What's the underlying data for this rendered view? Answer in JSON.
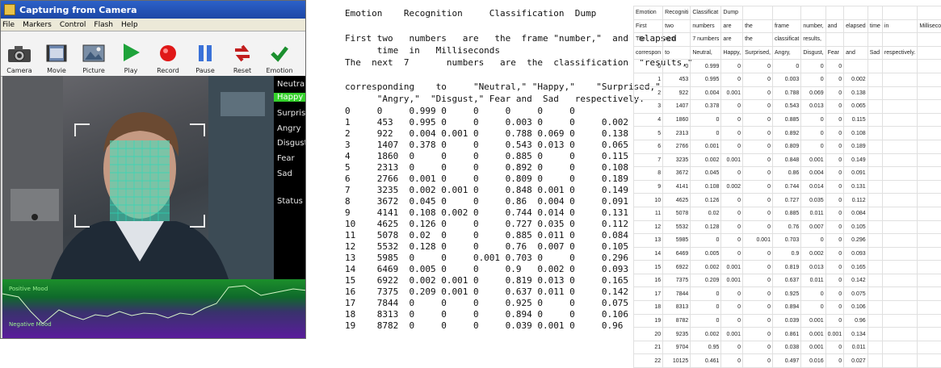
{
  "window": {
    "title": "Capturing from Camera",
    "menu": [
      "File",
      "Markers",
      "Control",
      "Flash",
      "Help"
    ],
    "toolbar": [
      {
        "label": "Camera",
        "icon": "camera-icon"
      },
      {
        "label": "Movie",
        "icon": "movie-icon"
      },
      {
        "label": "Picture",
        "icon": "picture-icon"
      },
      {
        "label": "Play",
        "icon": "play-icon"
      },
      {
        "label": "Record",
        "icon": "record-icon"
      },
      {
        "label": "Pause",
        "icon": "pause-icon"
      },
      {
        "label": "Reset",
        "icon": "reset-icon"
      },
      {
        "label": "Emotion",
        "icon": "checkmark-icon"
      }
    ],
    "emotions": [
      "Neutral",
      "Happy",
      "Surprised",
      "Angry",
      "Disgust",
      "Fear",
      "Sad"
    ],
    "selected_emotion": "Happy",
    "status_label": "Status",
    "mood_positive": "Positive Mood",
    "mood_negative": "Negative Mood",
    "colors": {
      "accent": "#35d22c",
      "title": "#2c61c8",
      "positive": "#1c8f2b",
      "negative": "#5a1c9c"
    }
  },
  "dump": {
    "lines": [
      "Emotion    Recognition     Classification  Dump",
      "",
      "First two   numbers   are   the  frame \"number,\"  and  elapsed",
      "      time  in   Milliseconds",
      "The  next  7       numbers   are  the  classification  \"results,\"",
      "",
      "corresponding    to     \"Neutral,\" \"Happy,\"    \"Surprised,\"",
      "      \"Angry,\"  \"Disgust,\" Fear and  Sad   respectively.",
      "0     0     0.999 0     0     0     0     0",
      "1     453   0.995 0     0     0.003 0     0     0.002",
      "2     922   0.004 0.001 0     0.788 0.069 0     0.138",
      "3     1407  0.378 0     0     0.543 0.013 0     0.065",
      "4     1860  0     0     0     0.885 0     0     0.115",
      "5     2313  0     0     0     0.892 0     0     0.108",
      "6     2766  0.001 0     0     0.809 0     0     0.189",
      "7     3235  0.002 0.001 0     0.848 0.001 0     0.149",
      "8     3672  0.045 0     0     0.86  0.004 0     0.091",
      "9     4141  0.108 0.002 0     0.744 0.014 0     0.131",
      "10    4625  0.126 0     0     0.727 0.035 0     0.112",
      "11    5078  0.02  0     0     0.885 0.011 0     0.084",
      "12    5532  0.128 0     0     0.76  0.007 0     0.105",
      "13    5985  0     0     0.001 0.703 0     0     0.296",
      "14    6469  0.005 0     0     0.9   0.002 0     0.093",
      "15    6922  0.002 0.001 0     0.819 0.013 0     0.165",
      "16    7375  0.209 0.001 0     0.637 0.011 0     0.142",
      "17    7844  0     0     0     0.925 0     0     0.075",
      "18    8313  0     0     0     0.894 0     0     0.106",
      "19    8782  0     0     0     0.039 0.001 0     0.96"
    ]
  },
  "sheet": {
    "header_rows": [
      [
        "Emotion",
        "Recogniti",
        "Classificat",
        "Dump",
        "",
        "",
        "",
        "",
        "",
        "",
        "",
        "",
        ""
      ],
      [
        "First",
        "two",
        "numbers",
        "are",
        "the",
        "frame",
        "number,",
        "and",
        "elapsed",
        "time",
        "in",
        "Milliseconds",
        ""
      ],
      [
        "The",
        "next",
        "7 numbers",
        "are",
        "the",
        "classificat",
        "results,",
        "",
        "",
        "",
        "",
        "",
        ""
      ],
      [
        "correspon",
        "to",
        "Neutral,",
        "Happy,",
        "Surprised,",
        "Angry,",
        "Disgust,",
        "Fear",
        "and",
        "Sad",
        "respectively.",
        "",
        ""
      ]
    ],
    "data_rows": [
      [
        "0",
        "0",
        "0.999",
        "0",
        "0",
        "0",
        "0",
        "0"
      ],
      [
        "1",
        "453",
        "0.995",
        "0",
        "0",
        "0.003",
        "0",
        "0",
        "0.002"
      ],
      [
        "2",
        "922",
        "0.004",
        "0.001",
        "0",
        "0.788",
        "0.069",
        "0",
        "0.138"
      ],
      [
        "3",
        "1407",
        "0.378",
        "0",
        "0",
        "0.543",
        "0.013",
        "0",
        "0.065"
      ],
      [
        "4",
        "1860",
        "0",
        "0",
        "0",
        "0.885",
        "0",
        "0",
        "0.115"
      ],
      [
        "5",
        "2313",
        "0",
        "0",
        "0",
        "0.892",
        "0",
        "0",
        "0.108"
      ],
      [
        "6",
        "2766",
        "0.001",
        "0",
        "0",
        "0.809",
        "0",
        "0",
        "0.189"
      ],
      [
        "7",
        "3235",
        "0.002",
        "0.001",
        "0",
        "0.848",
        "0.001",
        "0",
        "0.149"
      ],
      [
        "8",
        "3672",
        "0.045",
        "0",
        "0",
        "0.86",
        "0.004",
        "0",
        "0.091"
      ],
      [
        "9",
        "4141",
        "0.108",
        "0.002",
        "0",
        "0.744",
        "0.014",
        "0",
        "0.131"
      ],
      [
        "10",
        "4625",
        "0.126",
        "0",
        "0",
        "0.727",
        "0.035",
        "0",
        "0.112"
      ],
      [
        "11",
        "5078",
        "0.02",
        "0",
        "0",
        "0.885",
        "0.011",
        "0",
        "0.084"
      ],
      [
        "12",
        "5532",
        "0.128",
        "0",
        "0",
        "0.76",
        "0.007",
        "0",
        "0.105"
      ],
      [
        "13",
        "5985",
        "0",
        "0",
        "0.001",
        "0.703",
        "0",
        "0",
        "0.296"
      ],
      [
        "14",
        "6469",
        "0.005",
        "0",
        "0",
        "0.9",
        "0.002",
        "0",
        "0.093"
      ],
      [
        "15",
        "6922",
        "0.002",
        "0.001",
        "0",
        "0.819",
        "0.013",
        "0",
        "0.165"
      ],
      [
        "16",
        "7375",
        "0.209",
        "0.001",
        "0",
        "0.637",
        "0.011",
        "0",
        "0.142"
      ],
      [
        "17",
        "7844",
        "0",
        "0",
        "0",
        "0.925",
        "0",
        "0",
        "0.075"
      ],
      [
        "18",
        "8313",
        "0",
        "0",
        "0",
        "0.894",
        "0",
        "0",
        "0.106"
      ],
      [
        "19",
        "8782",
        "0",
        "0",
        "0",
        "0.039",
        "0.001",
        "0",
        "0.96"
      ],
      [
        "20",
        "9235",
        "0.002",
        "0.001",
        "0",
        "0.861",
        "0.001",
        "0.001",
        "0.134"
      ],
      [
        "21",
        "9704",
        "0.95",
        "0",
        "0",
        "0.038",
        "0.001",
        "0",
        "0.011"
      ],
      [
        "22",
        "10125",
        "0.461",
        "0",
        "0",
        "0.497",
        "0.016",
        "0",
        "0.027"
      ]
    ]
  }
}
